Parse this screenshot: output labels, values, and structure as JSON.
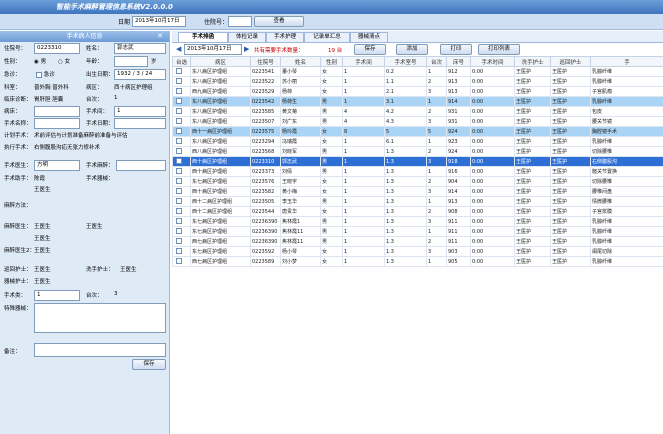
{
  "app": {
    "title": "智能手术麻醉管理信息系统V2.0.0.0"
  },
  "topbar": {
    "date_label": "日期",
    "date_value": "2013年10月17日",
    "bed_label": "住院号：",
    "query_label": "查看"
  },
  "left": {
    "header": "手术病人信息",
    "close": "✕",
    "fields": {
      "inpatient_no_label": "住院号：",
      "inpatient_no": "0223310",
      "name_label": "姓名：",
      "name": "郭志武",
      "gender_label": "性别：",
      "male": "男",
      "female": "女",
      "age_label": "年龄：",
      "age_unit": "岁",
      "urgent_label": "急诊：",
      "urgent_opt": "急诊",
      "birth_label": "出生日期：",
      "birth": "1932 / 3 / 24",
      "dept_label": "科室：",
      "dept": "普外胸 普外科",
      "ward_label": "病区：",
      "ward": "西十病区护理组",
      "diag_label": "临床诊断：",
      "diag": "胃肝胆 胆囊",
      "seq_label": "台次：",
      "seq": "1",
      "bed_label": "病床：",
      "op_label": "手术名称：",
      "op_date_label": "手术日期：",
      "op_name": "手术名称",
      "room_label": "手术间：",
      "room": "1",
      "sched_label": "计划手术：",
      "sched": "术前评估与计划准备麻醉前准备与评估",
      "exec_label": "执行手术：",
      "exec": "右侧腹股沟疝无张力修补术",
      "surgeon_label": "手术医生：",
      "surgeon": "方明",
      "anes_label": "手术麻醉：",
      "assist_label": "手术助手：",
      "assist": "陈霞",
      "equip_label": "手术器械：",
      "assist2": "王医生",
      "anes_method_label": "麻醉方法：",
      "anesthetist_label": "麻醉医生：",
      "anesthetist": "王医生",
      "anesthetist2": "王医生",
      "anes_assist_label": "王医生",
      "nurse_label": "麻醉医生2：",
      "nurse": "王医生",
      "circ_label": "巡回护士：",
      "circ": "王医生",
      "scrub_label": "洗手护士：",
      "scrub": "王医生",
      "nurse2_label": "器械护士：",
      "nurse2": "王医生",
      "op_type_label": "手术类：",
      "op_type": "1",
      "seq2_label": "台次：",
      "seq2": "3",
      "special_label": "特殊器械：",
      "remark_label": "备注：",
      "save": "保存"
    }
  },
  "tabs": [
    "手术排函",
    "体检记录",
    "手术护理",
    "记录单汇总",
    "器械清点"
  ],
  "toolbar": {
    "date": "2013年10月17日",
    "red_text": "共有需要手术数量：",
    "count": "19 台",
    "save": "保存",
    "add": "添加",
    "print": "打印",
    "print_list": "打印列表"
  },
  "columns": [
    "台选",
    "病区",
    "住院号",
    "姓名",
    "性别",
    "手术间",
    "手术室号",
    "台次",
    "床号",
    "手术时间",
    "洗手护士",
    "巡回护士",
    "手"
  ],
  "rows": [
    {
      "ward": "东八病区护理组",
      "id": "0223541",
      "name": "董小琴",
      "sex": "女",
      "room": "1",
      "no": "0.2",
      "seq": "1",
      "bed": "912",
      "time": "0:00",
      "n1": "王医护",
      "n2": "王医护",
      "op": "乳腺纤维"
    },
    {
      "ward": "东八病区护理组",
      "id": "0223522",
      "name": "苏小丽",
      "sex": "女",
      "room": "1",
      "no": "1.1",
      "seq": "2",
      "bed": "913",
      "time": "0:00",
      "n1": "王医护",
      "n2": "王医护",
      "op": "乳腺纤维"
    },
    {
      "ward": "西九病区护理组",
      "id": "0223529",
      "name": "杨荷",
      "sex": "女",
      "room": "1",
      "no": "2.1",
      "seq": "3",
      "bed": "913",
      "time": "0:00",
      "n1": "王医护",
      "n2": "王医护",
      "op": "子宫肌瘤"
    },
    {
      "ward": "东八病区护理组",
      "id": "0223542",
      "name": "杨荷生",
      "sex": "男",
      "room": "1",
      "no": "3.1",
      "seq": "1",
      "bed": "914",
      "time": "0:00",
      "n1": "王医护",
      "n2": "王医护",
      "op": "乳腺纤维",
      "cls": "hl"
    },
    {
      "ward": "东八病区护理组",
      "id": "0223585",
      "name": "黄文菊",
      "sex": "男",
      "room": "4",
      "no": "4.2",
      "seq": "2",
      "bed": "931",
      "time": "0:00",
      "n1": "王医护",
      "n2": "王医护",
      "op": "包皮"
    },
    {
      "ward": "东八病区护理组",
      "id": "0223507",
      "name": "刘广东",
      "sex": "男",
      "room": "4",
      "no": "4.3",
      "seq": "3",
      "bed": "931",
      "time": "0:00",
      "n1": "王医护",
      "n2": "王医护",
      "op": "腰关节镜"
    },
    {
      "ward": "西十一病区护理组",
      "id": "0223575",
      "name": "杨玲霞",
      "sex": "女",
      "room": "8",
      "no": "5",
      "seq": "5",
      "bed": "924",
      "time": "0:00",
      "n1": "王医护",
      "n2": "王医护",
      "op": "胸腔镜手术",
      "cls": "hl"
    },
    {
      "ward": "东八病区护理组",
      "id": "0223294",
      "name": "冯瑞霞",
      "sex": "女",
      "room": "1",
      "no": "6.1",
      "seq": "1",
      "bed": "923",
      "time": "0:00",
      "n1": "王医护",
      "n2": "王医护",
      "op": "乳腺纤维"
    },
    {
      "ward": "西八病区护理组",
      "id": "0223568",
      "name": "刘晓军",
      "sex": "男",
      "room": "1",
      "no": "1.3",
      "seq": "2",
      "bed": "924",
      "time": "0:00",
      "n1": "王医护",
      "n2": "王医护",
      "op": "切除腰椎"
    },
    {
      "ward": "西十病区护理组",
      "id": "0223310",
      "name": "郭志武",
      "sex": "男",
      "room": "1",
      "no": "1.3",
      "seq": "3",
      "bed": "918",
      "time": "0:00",
      "n1": "王医护",
      "n2": "王医护",
      "op": "右侧腹股沟",
      "cls": "sel"
    },
    {
      "ward": "西十病区护理组",
      "id": "0223373",
      "name": "刘倩",
      "sex": "男",
      "room": "1",
      "no": "1.3",
      "seq": "1",
      "bed": "916",
      "time": "0:00",
      "n1": "王医护",
      "n2": "王医护",
      "op": "髋关节置换"
    },
    {
      "ward": "东七病区护理组",
      "id": "0223576",
      "name": "王晓宇",
      "sex": "女",
      "room": "1",
      "no": "1.3",
      "seq": "2",
      "bed": "904",
      "time": "0:00",
      "n1": "王医护",
      "n2": "王医护",
      "op": "切除腰椎"
    },
    {
      "ward": "西十病区护理组",
      "id": "0223582",
      "name": "黄小梅",
      "sex": "女",
      "room": "1",
      "no": "1.3",
      "seq": "3",
      "bed": "914",
      "time": "0:00",
      "n1": "王医护",
      "n2": "王医护",
      "op": "腰椎间盘"
    },
    {
      "ward": "西十二病区护理组",
      "id": "0223505",
      "name": "李玉华",
      "sex": "男",
      "room": "1",
      "no": "1.3",
      "seq": "1",
      "bed": "913",
      "time": "0:00",
      "n1": "王医护",
      "n2": "王医护",
      "op": "情微腰椎"
    },
    {
      "ward": "西十二病区护理组",
      "id": "0223544",
      "name": "唐贵华",
      "sex": "女",
      "room": "1",
      "no": "1.3",
      "seq": "2",
      "bed": "908",
      "time": "0:00",
      "n1": "王医护",
      "n2": "王医护",
      "op": "子宫浆膜"
    },
    {
      "ward": "东七病区护理组",
      "id": "02236390",
      "name": "焦林霞1",
      "sex": "男",
      "room": "1",
      "no": "1.3",
      "seq": "3",
      "bed": "911",
      "time": "0:00",
      "n1": "王医护",
      "n2": "王医护",
      "op": "乳腺纤维"
    },
    {
      "ward": "东七病区护理组",
      "id": "02236390",
      "name": "焦林霞11",
      "sex": "男",
      "room": "1",
      "no": "1.3",
      "seq": "1",
      "bed": "911",
      "time": "0:00",
      "n1": "王医护",
      "n2": "王医护",
      "op": "乳腺纤维"
    },
    {
      "ward": "西七病区护理组",
      "id": "02236390",
      "name": "焦林霞11",
      "sex": "男",
      "room": "1",
      "no": "1.3",
      "seq": "2",
      "bed": "911",
      "time": "0:00",
      "n1": "王医护",
      "n2": "王医护",
      "op": "乳腺纤维"
    },
    {
      "ward": "东七病区护理组",
      "id": "0223592",
      "name": "杨小琴",
      "sex": "女",
      "room": "1",
      "no": "1.3",
      "seq": "3",
      "bed": "903",
      "time": "0:00",
      "n1": "王医护",
      "n2": "王医护",
      "op": "阑尾切除"
    },
    {
      "ward": "西七病区护理组",
      "id": "0223589",
      "name": "刘小梦",
      "sex": "女",
      "room": "1",
      "no": "1.3",
      "seq": "1",
      "bed": "905",
      "time": "0:00",
      "n1": "王医护",
      "n2": "王医护",
      "op": "乳腺纤维"
    }
  ]
}
